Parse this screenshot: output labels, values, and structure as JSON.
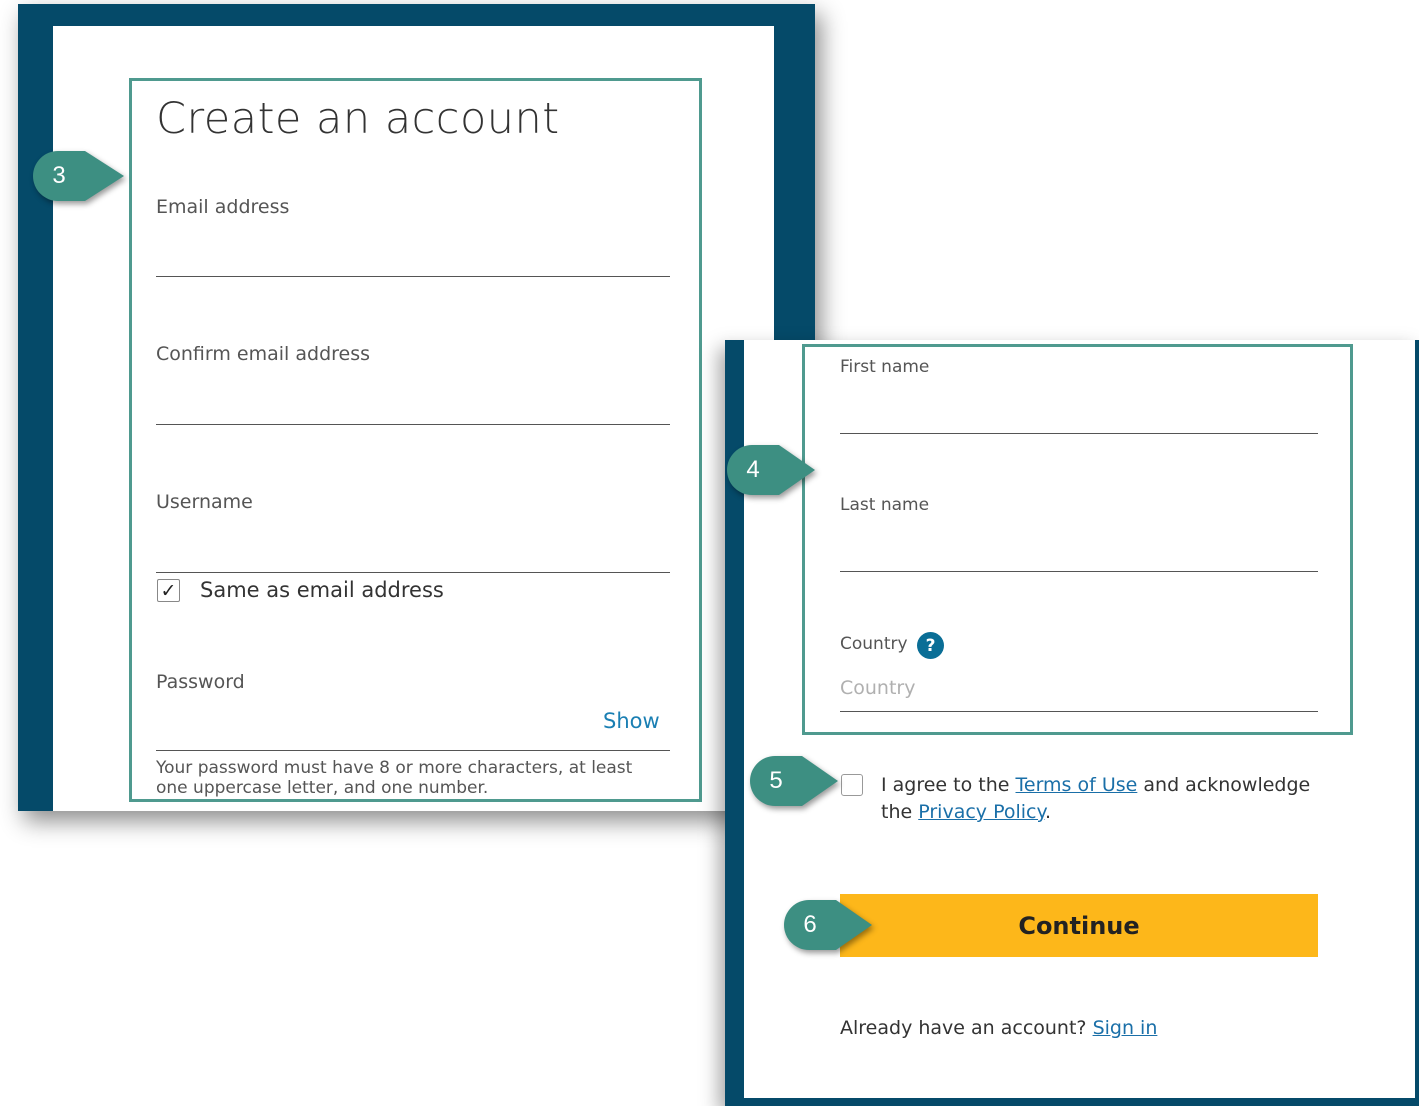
{
  "signup": {
    "title": "Create an account",
    "email_label": "Email address",
    "email_value": "",
    "confirm_email_label": "Confirm email address",
    "confirm_email_value": "",
    "username_label": "Username",
    "username_value": "",
    "same_as_email_label": "Same as email address",
    "same_as_email_checked": true,
    "checkmark": "✓",
    "password_label": "Password",
    "password_value": "",
    "show_label": "Show",
    "password_hint": "Your password must have 8 or more characters, at least one uppercase letter, and one number."
  },
  "profile": {
    "first_name_label": "First name",
    "first_name_value": "",
    "last_name_label": "Last name",
    "last_name_value": "",
    "country_label": "Country",
    "country_help_icon": "?",
    "country_placeholder": "Country"
  },
  "agreement": {
    "checked": false,
    "text_before": "I agree to the ",
    "terms_link": "Terms of Use",
    "text_middle": " and acknowledge the ",
    "privacy_link": "Privacy Policy",
    "text_after": "."
  },
  "continue_label": "Continue",
  "signin": {
    "prompt": "Already have an account? ",
    "link": "Sign in"
  },
  "callouts": [
    "3",
    "4",
    "5",
    "6"
  ],
  "colors": {
    "frame": "#054a69",
    "highlight_border": "#4f9a8f",
    "callout": "#3d8f82",
    "continue_button": "#fdb71a",
    "link": "#1a6fa8",
    "help_icon": "#0a6e96"
  }
}
